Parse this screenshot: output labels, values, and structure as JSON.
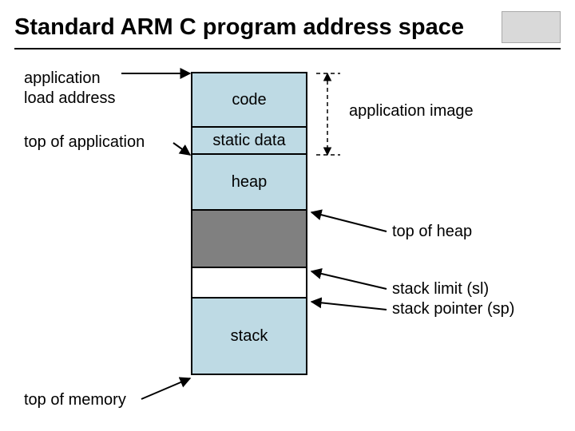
{
  "title": "Standard ARM C program address space",
  "segments": {
    "code": "code",
    "static_data": "static data",
    "heap": "heap",
    "stack": "stack"
  },
  "labels": {
    "application_load_address": "application\nload address",
    "top_of_application": "top of application",
    "application_image": "application image",
    "top_of_heap": "top of heap",
    "stack_limit_pointer": "stack limit (sl)\nstack pointer (sp)",
    "top_of_memory": "top of memory"
  }
}
